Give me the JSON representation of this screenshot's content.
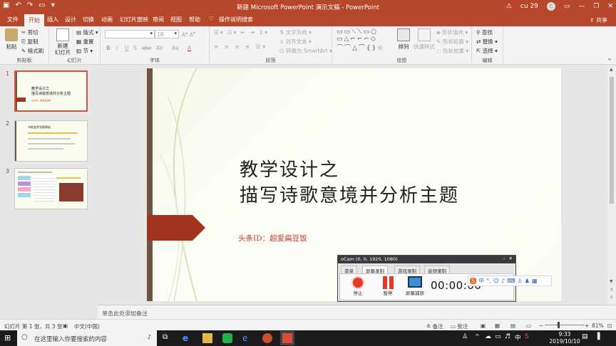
{
  "window": {
    "title": "新建 Microsoft PowerPoint 演示文稿 - PowerPoint",
    "user_name": "cu 29",
    "user_initial": "C"
  },
  "tabs": {
    "items": [
      "文件",
      "开始",
      "插入",
      "设计",
      "切换",
      "动画",
      "幻灯片放映",
      "审阅",
      "视图",
      "帮助",
      "操作说明搜索"
    ],
    "active": "开始",
    "share": "共享"
  },
  "ribbon": {
    "clipboard": {
      "paste": "粘贴",
      "cut": "剪切",
      "copy": "复制",
      "format_painter": "格式刷",
      "group": "剪贴板"
    },
    "slides": {
      "new_slide": "新建\n幻灯片",
      "layout": "版式",
      "reset": "重置",
      "section": "节",
      "group": "幻灯片"
    },
    "font": {
      "size": "18",
      "bold": "B",
      "italic": "I",
      "underline": "U",
      "shadow": "S",
      "strike": "abc",
      "spacing": "AV",
      "case": "Aa",
      "color": "A",
      "group": "字体"
    },
    "paragraph": {
      "text_direction": "文字方向",
      "align_text": "对齐文本",
      "smartart": "转换为 SmartArt",
      "group": "段落"
    },
    "drawing": {
      "arrange": "排列",
      "quick_styles": "快速样式",
      "fill": "形状填充",
      "outline": "形状轮廓",
      "effects": "形状效果",
      "group": "绘图"
    },
    "editing": {
      "find": "查找",
      "replace": "替换",
      "select": "选择",
      "group": "编辑"
    }
  },
  "thumbnails": [
    {
      "number": "1",
      "line1": "教学设计之",
      "line2": "描写诗歌意境并分析主题",
      "sub": "头条ID：超爱扁豆饭"
    },
    {
      "number": "2",
      "title": "诗歌鉴赏答题模板"
    },
    {
      "number": "3"
    }
  ],
  "slide": {
    "title_line1": "教学设计之",
    "title_line2": "描写诗歌意境并分析主题",
    "subtitle": "头条ID：超爱扁豆饭"
  },
  "notes_placeholder": "单击此处添加备注",
  "status": {
    "slide_info": "幻灯片 第 1 张，共 3 张",
    "language": "中文(中国)",
    "notes": "备注",
    "comments": "批注",
    "zoom": "81%"
  },
  "ocam": {
    "title": "oCam (0, 0, 1920, 1080)",
    "tabs": [
      "菜单",
      "屏幕录制",
      "游戏录制",
      "音频录制"
    ],
    "active_tab": "屏幕录制",
    "stop": "停止",
    "pause": "暂停",
    "capture": "屏幕捕获",
    "timer": "00:00:00"
  },
  "ime": {
    "lang": "中"
  },
  "taskbar": {
    "search_placeholder": "在这里输入你要搜索的内容",
    "time": "9:33",
    "date": "2019/10/10",
    "input_method": "中"
  },
  "colors": {
    "accent": "#b7472a",
    "slide_arrow": "#a2321d",
    "subtitle": "#c0392b"
  }
}
